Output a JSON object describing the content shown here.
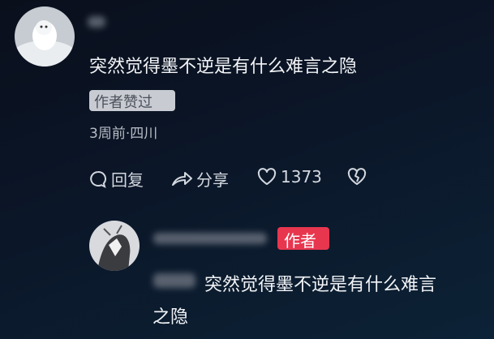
{
  "comment": {
    "text": "突然觉得墨不逆是有什么难言之隐",
    "badge": "作者赞过",
    "meta": "3周前·四川",
    "actions": {
      "reply": "回复",
      "share": "分享",
      "likes": "1373"
    }
  },
  "reply": {
    "author_tag": "作者",
    "text_line1": "突然觉得墨不逆是有什么难言",
    "text_line2": "之隐"
  },
  "icons": [
    "reply-icon",
    "share-icon",
    "heart-icon",
    "dislike-heart-icon"
  ],
  "colors": {
    "author_tag": "#e8364f",
    "badge_bg": "#c8ccd2"
  }
}
